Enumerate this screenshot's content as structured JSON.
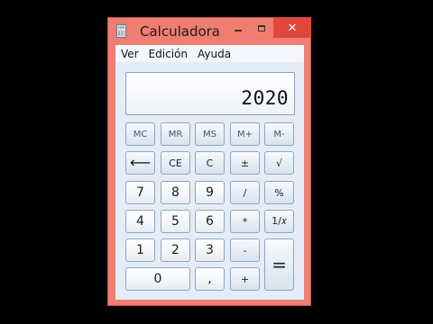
{
  "window": {
    "title": "Calculadora",
    "close_label": "✕"
  },
  "menu": [
    {
      "label": "Ver"
    },
    {
      "label": "Edición"
    },
    {
      "label": "Ayuda"
    }
  ],
  "display": {
    "value": "2020"
  },
  "keys": {
    "mc": "MC",
    "mr": "MR",
    "ms": "MS",
    "mplus": "M+",
    "mminus": "M-",
    "backspace": "⟵",
    "ce": "CE",
    "c": "C",
    "plusminus": "±",
    "sqrt": "√",
    "seven": "7",
    "eight": "8",
    "nine": "9",
    "divide": "/",
    "percent": "%",
    "four": "4",
    "five": "5",
    "six": "6",
    "multiply": "*",
    "reciprocal": "1/𝑥",
    "one": "1",
    "two": "2",
    "three": "3",
    "minus": "-",
    "equals": "=",
    "zero": "0",
    "decimal": ",",
    "plus": "+"
  },
  "colors": {
    "frame": "#ee7d72",
    "close_button": "#e0473a",
    "client_background": "#e4ecf7"
  },
  "icons": {
    "app": "calculator-icon",
    "minimize": "minimize-icon",
    "maximize": "maximize-icon",
    "close": "close-icon",
    "backspace": "backspace-arrow-icon"
  }
}
